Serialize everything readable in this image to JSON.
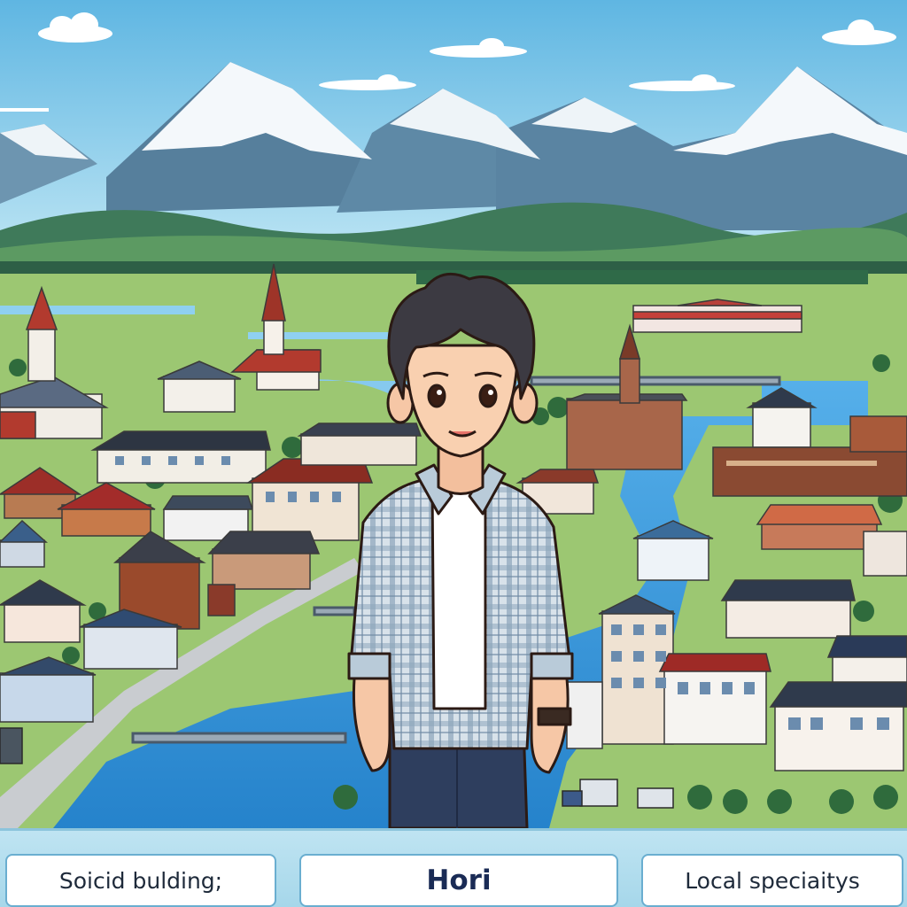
{
  "labels": {
    "left": "Soicid bulding;",
    "center": "Hori",
    "right": "Local speciaitys"
  },
  "colors": {
    "sky": "#7fc8e8",
    "snow": "#f4f8fb",
    "mountain": "#4f7b96",
    "river": "#2f8fd6",
    "grass": "#8cc063",
    "shirt": "#b9cbd9",
    "label_border": "#6aaed0"
  },
  "scene": {
    "subject": "young man in plaid shirt standing in front of a town",
    "elements": [
      "mountain-range",
      "town",
      "river",
      "bridge",
      "church",
      "trees",
      "clouds"
    ]
  }
}
